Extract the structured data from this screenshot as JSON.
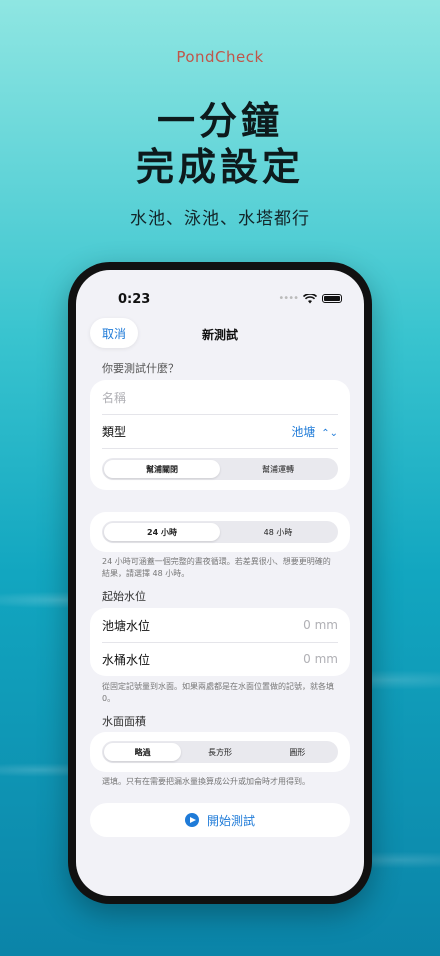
{
  "brand": "PondCheck",
  "headline": {
    "line1": "一分鐘",
    "line2": "完成設定"
  },
  "subline": "水池、泳池、水塔都行",
  "status": {
    "time": "0:23"
  },
  "nav": {
    "cancel": "取消",
    "title": "新測試"
  },
  "what_section": {
    "caption": "你要測試什麼？",
    "name_placeholder": "名稱",
    "type_label": "類型",
    "type_value": "池塘",
    "pump_segment": [
      {
        "label": "幫浦關閉",
        "active": true
      },
      {
        "label": "幫浦運轉",
        "active": false
      }
    ]
  },
  "duration": {
    "options": [
      {
        "label": "24 小時",
        "active": true
      },
      {
        "label": "48 小時",
        "active": false
      }
    ],
    "note": "24 小時可涵蓋一個完整的晝夜循環。若差異很小、想要更明確的結果，請選擇 48 小時。"
  },
  "water_level": {
    "header": "起始水位",
    "pond_label": "池塘水位",
    "pond_value": "0 mm",
    "bucket_label": "水桶水位",
    "bucket_value": "0 mm",
    "note": "從固定記號量到水面。如果兩處都是在水面位置做的記號，就各填 0。"
  },
  "surface_area": {
    "header": "水面面積",
    "options": [
      {
        "label": "略過",
        "active": true
      },
      {
        "label": "長方形",
        "active": false
      },
      {
        "label": "圓形",
        "active": false
      }
    ],
    "note": "選填。只有在需要把漏水量換算成公升或加侖時才用得到。"
  },
  "start_button": "開始測試",
  "colors": {
    "accent": "#1f7bd8",
    "brand": "#c0564a"
  }
}
